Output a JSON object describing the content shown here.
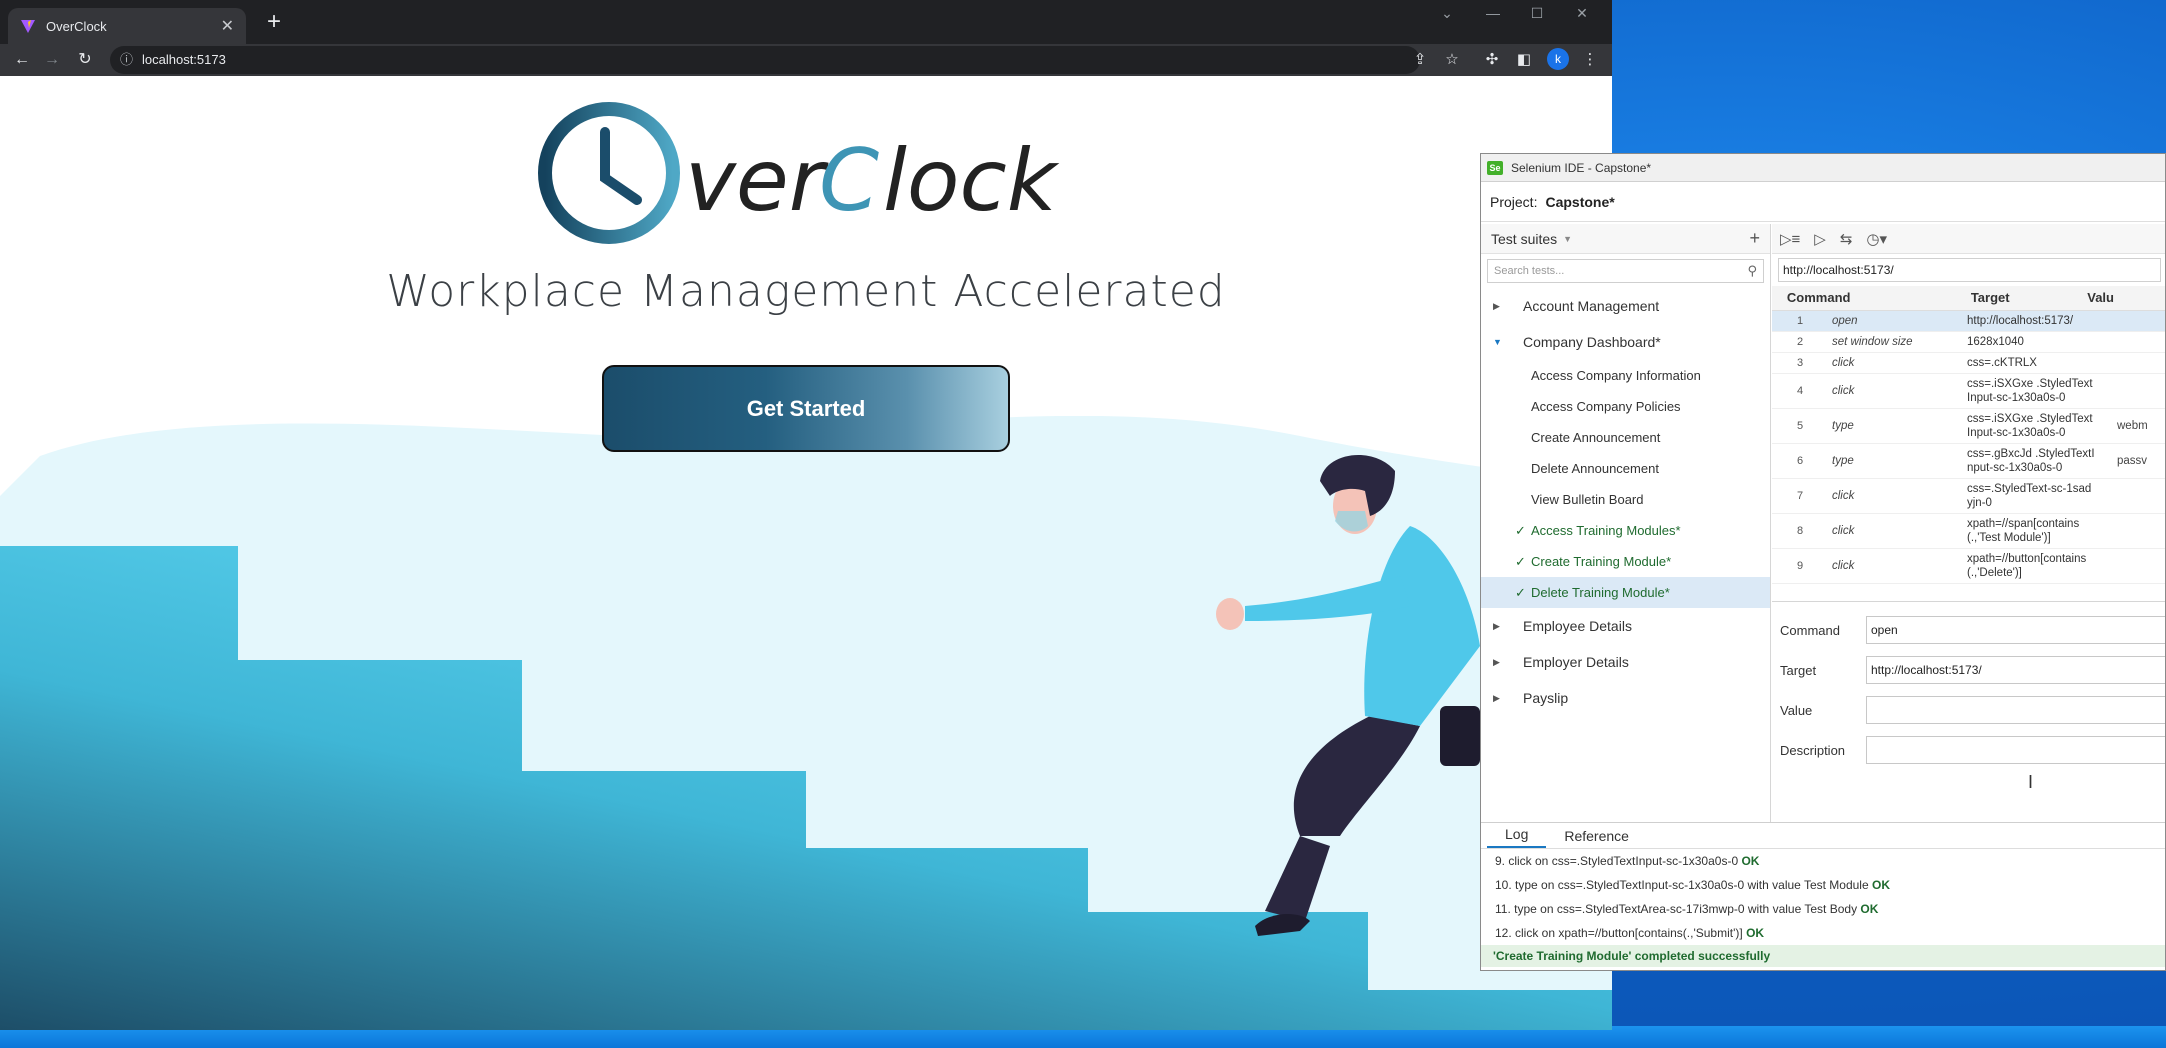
{
  "browser": {
    "tab_title": "OverClock",
    "url": "localhost:5173",
    "profile_initial": "k"
  },
  "page": {
    "logo_text": "OverClock",
    "tagline": "Workplace Management Accelerated",
    "cta_label": "Get Started"
  },
  "ide": {
    "window_title": "Selenium IDE - Capstone*",
    "project_label": "Project:",
    "project_name": "Capstone*",
    "suites_header": "Test suites",
    "search_placeholder": "Search tests...",
    "base_url": "http://localhost:5173/",
    "suites": [
      {
        "name": "Account Management",
        "open": false
      },
      {
        "name": "Company Dashboard*",
        "open": true
      },
      {
        "name": "Employee Details",
        "open": false
      },
      {
        "name": "Employer Details",
        "open": false
      },
      {
        "name": "Payslip",
        "open": false
      }
    ],
    "tests": [
      {
        "name": "Access Company Information",
        "passed": false
      },
      {
        "name": "Access Company Policies",
        "passed": false
      },
      {
        "name": "Create Announcement",
        "passed": false
      },
      {
        "name": "Delete Announcement",
        "passed": false
      },
      {
        "name": "View Bulletin Board",
        "passed": false
      },
      {
        "name": "Access Training Modules*",
        "passed": true
      },
      {
        "name": "Create Training Module*",
        "passed": true
      },
      {
        "name": "Delete Training Module*",
        "passed": true,
        "selected": true
      }
    ],
    "columns": [
      "Command",
      "Target",
      "Valu"
    ],
    "commands": [
      {
        "n": "1",
        "cmd": "open",
        "target": "http://localhost:5173/",
        "value": ""
      },
      {
        "n": "2",
        "cmd": "set window size",
        "target": "1628x1040",
        "value": ""
      },
      {
        "n": "3",
        "cmd": "click",
        "target": "css=.cKTRLX",
        "value": ""
      },
      {
        "n": "4",
        "cmd": "click",
        "target": "css=.iSXGxe .StyledText Input-sc-1x30a0s-0",
        "value": ""
      },
      {
        "n": "5",
        "cmd": "type",
        "target": "css=.iSXGxe .StyledText Input-sc-1x30a0s-0",
        "value": "webm"
      },
      {
        "n": "6",
        "cmd": "type",
        "target": "css=.gBxcJd .StyledTextI nput-sc-1x30a0s-0",
        "value": "passv"
      },
      {
        "n": "7",
        "cmd": "click",
        "target": "css=.StyledText-sc-1sad yjn-0",
        "value": ""
      },
      {
        "n": "8",
        "cmd": "click",
        "target": "xpath=//span[contains (.,'Test Module')]",
        "value": ""
      },
      {
        "n": "9",
        "cmd": "click",
        "target": "xpath=//button[contains (.,'Delete')]",
        "value": ""
      }
    ],
    "details": {
      "command_label": "Command",
      "command_value": "open",
      "target_label": "Target",
      "target_value": "http://localhost:5173/",
      "value_label": "Value",
      "value_value": "",
      "description_label": "Description",
      "description_value": ""
    },
    "log_tabs": [
      "Log",
      "Reference"
    ],
    "log_lines": [
      {
        "text": "9.  click on css=.StyledTextInput-sc-1x30a0s-0",
        "status": "OK"
      },
      {
        "text": "10. type on css=.StyledTextInput-sc-1x30a0s-0 with value Test Module",
        "status": "OK"
      },
      {
        "text": "11. type on css=.StyledTextArea-sc-17i3mwp-0 with value Test Body",
        "status": "OK"
      },
      {
        "text": "12. click on xpath=//button[contains(.,'Submit')]",
        "status": "OK"
      }
    ],
    "log_final": "'Create Training Module' completed successfully"
  },
  "colors": {
    "brand_dark": "#1b4d6b",
    "brand_light": "#5fd6f3",
    "pass_green": "#1f6b2f"
  }
}
